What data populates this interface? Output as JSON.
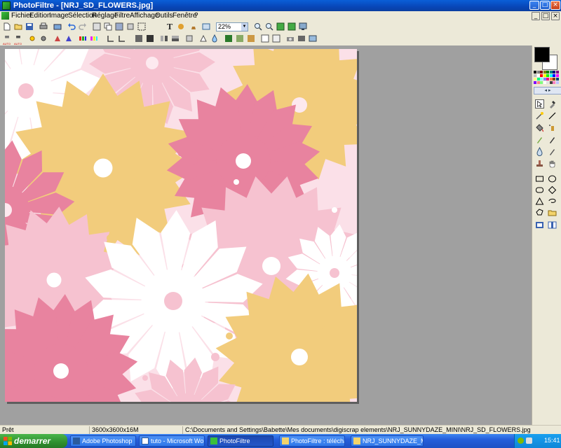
{
  "window": {
    "title": "PhotoFiltre - [NRJ_SD_FLOWERS.jpg]",
    "buttons": {
      "minimize": "_",
      "maximize": "□",
      "close": "×"
    }
  },
  "menu": [
    "Fichier",
    "Edition",
    "Image",
    "Sélection",
    "Réglage",
    "Filtre",
    "Affichage",
    "Outils",
    "Fenêtre",
    "?"
  ],
  "toolbar": {
    "zoom_value": "22%",
    "auto_label_1": "AUTO",
    "auto_label_2": "AUTO"
  },
  "palette": {
    "foreground_color": "#000000",
    "background_color": "#ffffff",
    "swatches": [
      "#000000",
      "#808080",
      "#800000",
      "#808000",
      "#008000",
      "#008080",
      "#000080",
      "#800080",
      "#c0c0c0",
      "#ffffff",
      "#ff0000",
      "#ffff00",
      "#00ff00",
      "#00ffff",
      "#0000ff",
      "#ff00ff",
      "#ffff80",
      "#00ff80",
      "#80ffff",
      "#8080ff",
      "#ff0080",
      "#ff8040",
      "#804000",
      "#004080",
      "#8000ff",
      "#ff8080",
      "#80ff80",
      "#ffffff",
      "#e0e0e0",
      "#404040",
      "#ff80c0",
      "#c0c0ff"
    ]
  },
  "status": {
    "state": "Prêt",
    "dimensions": "3600x3600x16M",
    "path": "C:\\Documents and Settings\\Babette\\Mes documents\\digiscrap elements\\NRJ_SUNNYDAZE_MINI\\NRJ_SD_FLOWERS.jpg"
  },
  "taskbar": {
    "start_label": "demarrer",
    "tasks": [
      "Adobe Photoshop",
      "tuto - Microsoft Word",
      "PhotoFiltre",
      "PhotoFiltre : téléchar...",
      "NRJ_SUNNYDAZE_MINI"
    ],
    "time": "15:41"
  },
  "colors": {
    "pink_dark": "#e8839f",
    "pink_light": "#f6c2d0",
    "yellow": "#f2cc7c",
    "white": "#ffffff"
  }
}
